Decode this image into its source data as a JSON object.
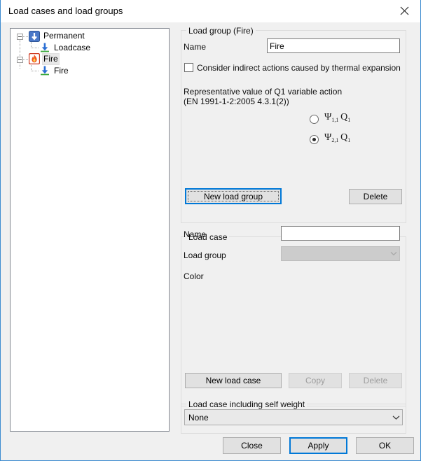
{
  "window": {
    "title": "Load cases and load groups",
    "close_icon": "close-icon"
  },
  "tree": {
    "nodes": [
      {
        "label": "Permanent",
        "icon": "permanent-arrow-icon",
        "level": 0,
        "expanded": true,
        "selected": false
      },
      {
        "label": "Loadcase",
        "icon": "loadcase-arrow-icon",
        "level": 1,
        "expanded": false,
        "selected": false
      },
      {
        "label": "Fire",
        "icon": "fire-flame-icon",
        "level": 0,
        "expanded": true,
        "selected": true
      },
      {
        "label": "Fire",
        "icon": "loadcase-arrow-icon",
        "level": 1,
        "expanded": false,
        "selected": false
      }
    ]
  },
  "load_group": {
    "legend": "Load group (Fire)",
    "name_label": "Name",
    "name_value": "Fire",
    "name_placeholder": "",
    "checkbox_label": "Consider indirect actions caused by thermal expansion",
    "checkbox_checked": false,
    "representative_line1": "Representative value of Q1 variable action",
    "representative_line2": "(EN 1991-1-2:2005 4.3.1(2))",
    "options": [
      {
        "id": "psi11",
        "symbol": "Ψ",
        "sub": "1,1",
        "factor": "Q",
        "factor_sub": "1",
        "selected": false
      },
      {
        "id": "psi21",
        "symbol": "Ψ",
        "sub": "2,1",
        "factor": "Q",
        "factor_sub": "1",
        "selected": true
      }
    ],
    "new_button": "New load group",
    "new_button_focused": true,
    "delete_button": "Delete",
    "delete_disabled": false
  },
  "load_case": {
    "legend": "Load case",
    "name_label": "Name",
    "name_value": "",
    "name_placeholder": "",
    "group_label": "Load group",
    "group_value": "",
    "group_disabled": true,
    "color_label": "Color",
    "new_button": "New load case",
    "copy_button": "Copy",
    "copy_disabled": true,
    "delete_button": "Delete",
    "delete_disabled": true
  },
  "self_weight": {
    "legend": "Load case including self weight",
    "value": "None",
    "options": [
      "None"
    ]
  },
  "dialog_buttons": {
    "close": "Close",
    "apply": "Apply",
    "ok": "OK",
    "default_button": "Apply"
  },
  "colors": {
    "accent": "#0078d7",
    "window_border": "#3c8bd0",
    "face": "#f0f0f0",
    "groupbox_border": "#dcdcdc",
    "permanent_icon": "#4472c4",
    "fire_icon": "#e8432b",
    "arrow_icon": "#2b6fd4",
    "ground_line": "#3faa3f"
  }
}
